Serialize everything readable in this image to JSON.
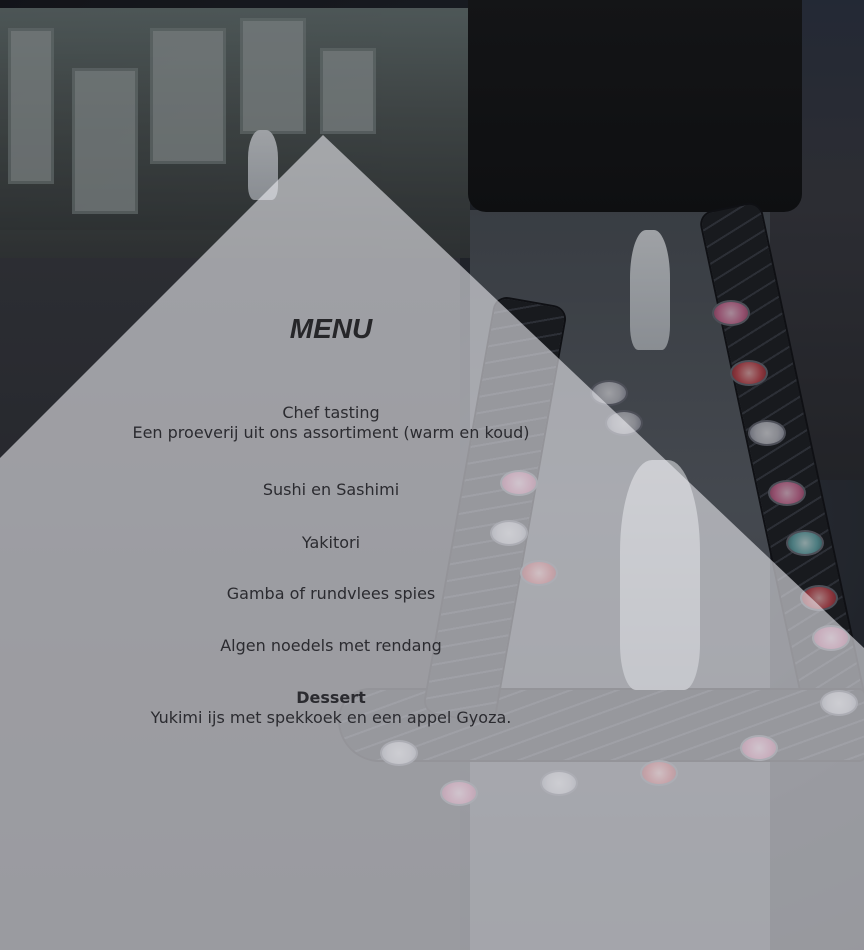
{
  "menu": {
    "title": "MENU",
    "items": [
      {
        "name": "Chef tasting",
        "description": "Een proeverij uit ons assortiment (warm en koud)"
      },
      {
        "name": "Sushi en Sashimi"
      },
      {
        "name": "Yakitori"
      },
      {
        "name": "Gamba of rundvlees spies"
      },
      {
        "name": "Algen noedels met rendang"
      }
    ],
    "dessert": {
      "heading": "Dessert",
      "description": "Yukimi ijs met spekkoek en een appel Gyoza."
    }
  },
  "colors": {
    "overlay": "#e9e9ee",
    "text": "#2b2b30"
  },
  "background": {
    "description_icon": "restaurant-photo"
  }
}
